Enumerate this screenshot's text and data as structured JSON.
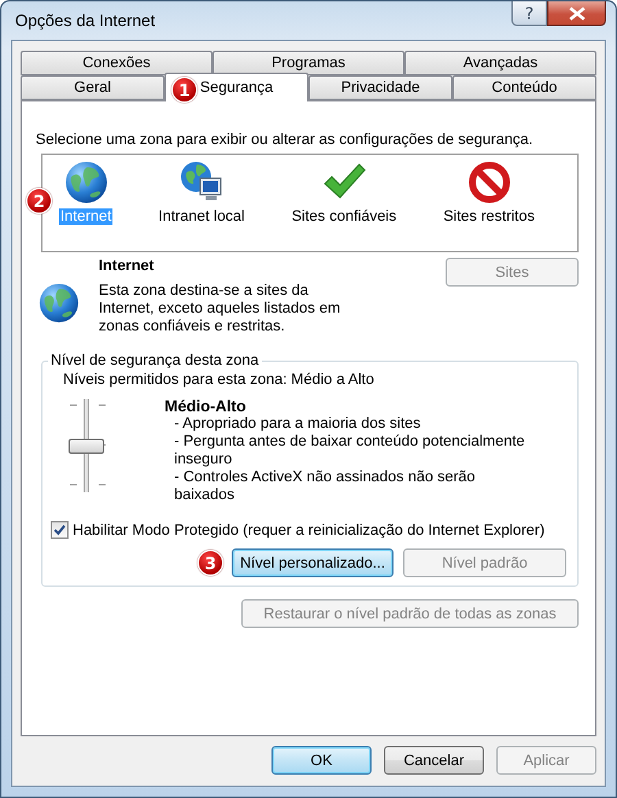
{
  "window": {
    "title": "Opções da Internet",
    "help": "?"
  },
  "tab_rows": [
    [
      {
        "label": "Conexões",
        "selected": false
      },
      {
        "label": "Programas",
        "selected": false
      },
      {
        "label": "Avançadas",
        "selected": false
      }
    ],
    [
      {
        "label": "Geral",
        "selected": false
      },
      {
        "label": "Segurança",
        "selected": true,
        "badge": "1"
      },
      {
        "label": "Privacidade",
        "selected": false
      },
      {
        "label": "Conteúdo",
        "selected": false
      }
    ]
  ],
  "zone_prompt": "Selecione uma zona para exibir ou alterar as configurações de segurança.",
  "zones": [
    {
      "kind": "globe",
      "label": "Internet",
      "selected": true,
      "badge": "2"
    },
    {
      "kind": "intranet",
      "label": "Intranet local",
      "selected": false
    },
    {
      "kind": "trusted",
      "label": "Sites confiáveis",
      "selected": false
    },
    {
      "kind": "restricted",
      "label": "Sites restritos",
      "selected": false
    }
  ],
  "zone_detail": {
    "kind": "globe",
    "title": "Internet",
    "description": "Esta zona destina-se a sites da Internet, exceto aqueles listados em zonas confiáveis e restritas.",
    "sites_button": {
      "label": "Sites",
      "disabled": true
    }
  },
  "security_level": {
    "legend": "Nível de segurança desta zona",
    "allowed": "Níveis permitidos para esta zona: Médio a Alto",
    "level": 0.5,
    "level_name": "Médio-Alto",
    "bullets": [
      "- Apropriado para a maioria dos sites",
      "- Pergunta antes de baixar conteúdo potencialmente inseguro",
      "- Controles ActiveX não assinados não serão baixados"
    ],
    "protected_mode": {
      "label": "Habilitar Modo Protegido (requer a reinicialização do Internet Explorer)",
      "checked": true
    },
    "buttons": [
      {
        "label": "Nível personalizado...",
        "disabled": false,
        "badge": "3"
      },
      {
        "label": "Nível padrão",
        "disabled": true
      }
    ]
  },
  "restore_button": {
    "label": "Restaurar o nível padrão de todas as zonas",
    "disabled": true
  },
  "footer_buttons": [
    {
      "label": "OK",
      "disabled": false,
      "default": true
    },
    {
      "label": "Cancelar",
      "disabled": false,
      "default": false
    },
    {
      "label": "Aplicar",
      "disabled": true,
      "default": false
    }
  ]
}
